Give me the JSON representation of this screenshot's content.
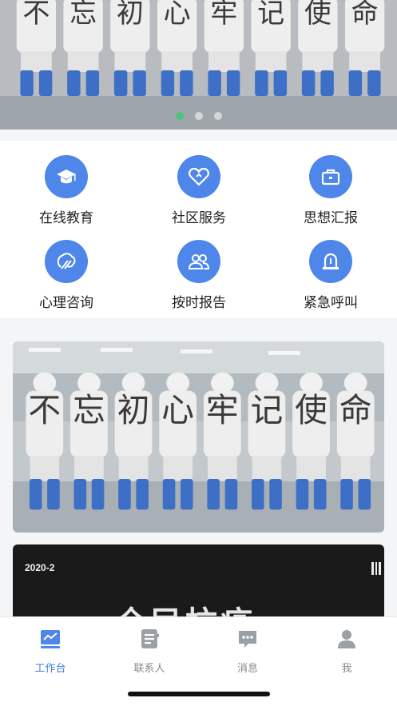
{
  "banner": {
    "calligraphy": [
      "不",
      "忘",
      "初",
      "心",
      "牢",
      "记",
      "使",
      "命"
    ],
    "dots": [
      true,
      false,
      false
    ]
  },
  "functions": [
    {
      "label": "在线教育",
      "icon": "graduation-cap-icon"
    },
    {
      "label": "社区服务",
      "icon": "heart-icon"
    },
    {
      "label": "思想汇报",
      "icon": "briefcase-icon"
    },
    {
      "label": "心理咨询",
      "icon": "psychology-icon"
    },
    {
      "label": "按时报告",
      "icon": "group-icon"
    },
    {
      "label": "紧急呼叫",
      "icon": "alarm-light-icon"
    }
  ],
  "articles": {
    "photo1": {
      "calligraphy": [
        "不",
        "忘",
        "初",
        "心",
        "牢",
        "记",
        "使",
        "命"
      ]
    },
    "photo2": {
      "date": "2020-2",
      "title": "全民抗疫"
    }
  },
  "tabbar": {
    "tabs": [
      {
        "label": "工作台",
        "icon": "workbench-icon",
        "active": true
      },
      {
        "label": "联系人",
        "icon": "contacts-icon",
        "active": false
      },
      {
        "label": "消息",
        "icon": "message-icon",
        "active": false
      },
      {
        "label": "我",
        "icon": "user-icon",
        "active": false
      }
    ]
  },
  "colors": {
    "accent": "#4f86ea",
    "tab_active": "#3f7de0",
    "carousel_active_dot": "#43c777"
  }
}
